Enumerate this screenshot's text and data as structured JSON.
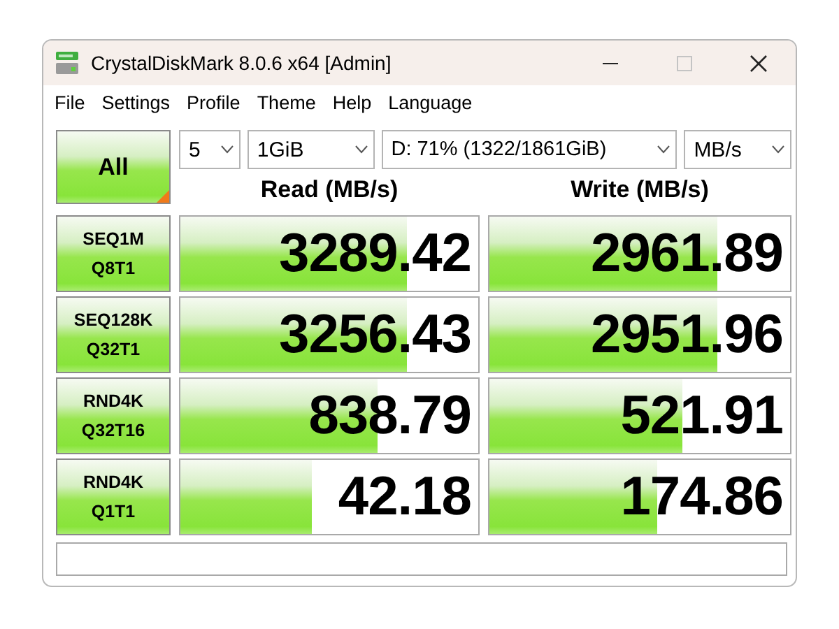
{
  "window": {
    "title": "CrystalDiskMark 8.0.6 x64 [Admin]",
    "maximize_disabled": true
  },
  "menu": [
    "File",
    "Settings",
    "Profile",
    "Theme",
    "Help",
    "Language"
  ],
  "all_button": {
    "label": "All"
  },
  "selectors": [
    {
      "value": "5"
    },
    {
      "value": "1GiB"
    },
    {
      "value": "D: 71% (1322/1861GiB)"
    },
    {
      "value": "MB/s"
    }
  ],
  "columns": [
    "Read (MB/s)",
    "Write (MB/s)"
  ],
  "tests": [
    {
      "name": "SEQ1M",
      "params": "Q8T1",
      "read": {
        "value": "3289.42",
        "level": 0.76
      },
      "write": {
        "value": "2961.89",
        "level": 0.76
      }
    },
    {
      "name": "SEQ128K",
      "params": "Q32T1",
      "read": {
        "value": "3256.43",
        "level": 0.76
      },
      "write": {
        "value": "2951.96",
        "level": 0.76
      }
    },
    {
      "name": "RND4K",
      "params": "Q32T16",
      "read": {
        "value": "838.79",
        "level": 0.66
      },
      "write": {
        "value": "521.91",
        "level": 0.64
      }
    },
    {
      "name": "RND4K",
      "params": "Q1T1",
      "read": {
        "value": "42.18",
        "level": 0.44
      },
      "write": {
        "value": "174.86",
        "level": 0.56
      }
    }
  ]
}
